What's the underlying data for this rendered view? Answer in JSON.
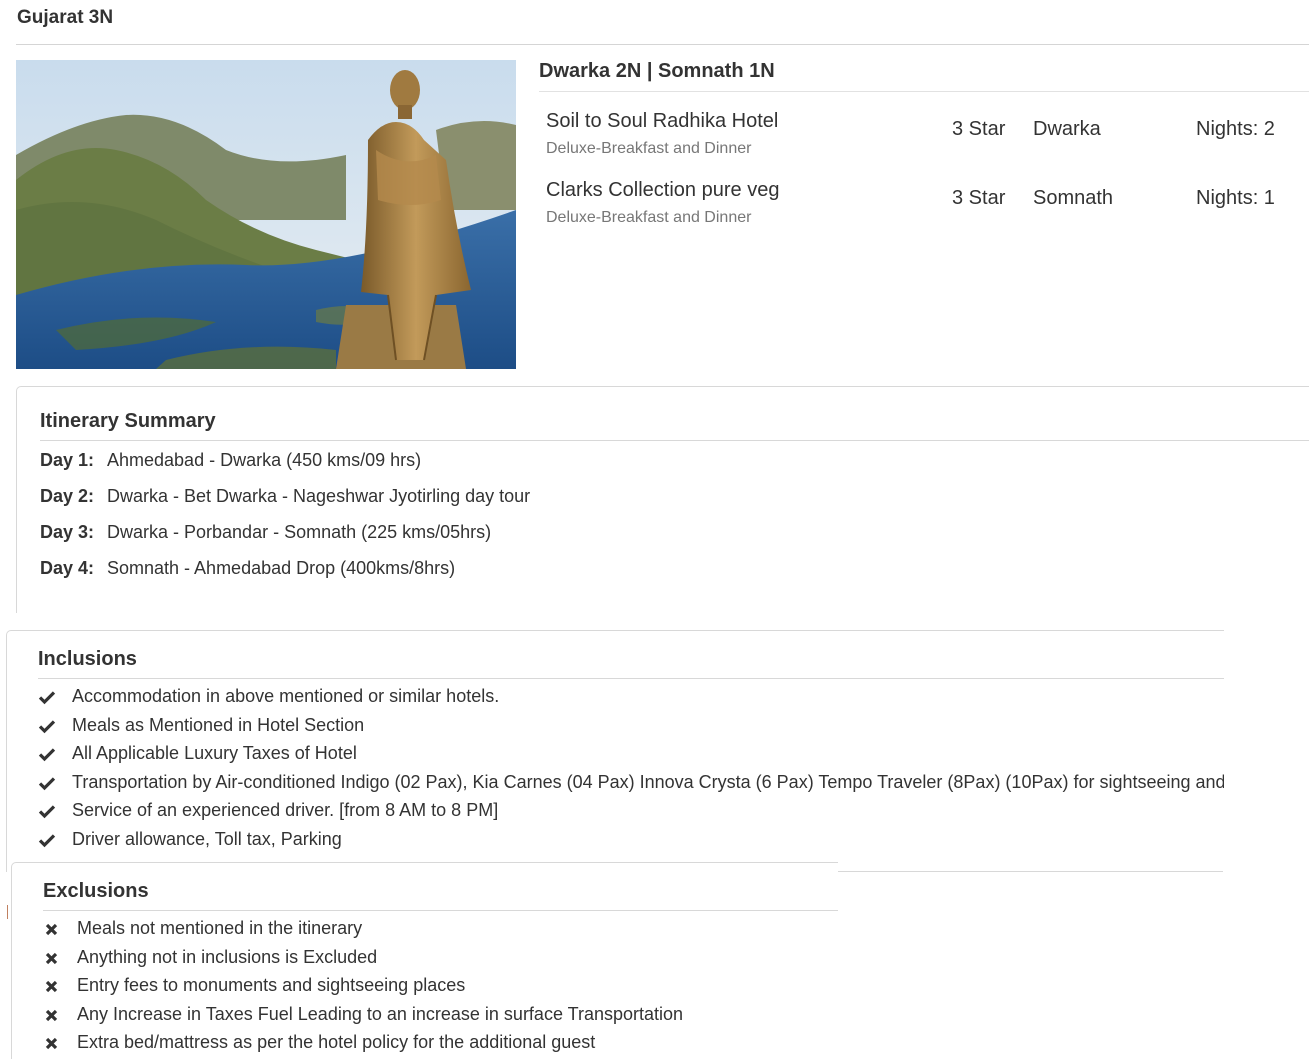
{
  "package": {
    "title": "Gujarat 3N"
  },
  "hero": {
    "alt_icon": "statue-of-unity-photo"
  },
  "hotels": {
    "route_title": "Dwarka 2N | Somnath 1N",
    "items": [
      {
        "name": "Soil to Soul Radhika Hotel",
        "meal_plan": "Deluxe-Breakfast and Dinner",
        "rating": "3 Star",
        "city": "Dwarka",
        "nights": "Nights: 2"
      },
      {
        "name": "Clarks Collection pure veg",
        "meal_plan": "Deluxe-Breakfast and Dinner",
        "rating": "3 Star",
        "city": "Somnath",
        "nights": "Nights: 1"
      }
    ]
  },
  "itinerary": {
    "title": "Itinerary Summary",
    "days": [
      {
        "label": "Day 1:",
        "text": "Ahmedabad - Dwarka (450 kms/09 hrs)"
      },
      {
        "label": "Day 2:",
        "text": "Dwarka - Bet Dwarka - Nageshwar Jyotirling day tour"
      },
      {
        "label": "Day 3:",
        "text": "Dwarka - Porbandar - Somnath (225 kms/05hrs)"
      },
      {
        "label": "Day 4:",
        "text": "Somnath - Ahmedabad Drop (400kms/8hrs)"
      }
    ]
  },
  "inclusions": {
    "title": "Inclusions",
    "icon": "check-icon",
    "items": [
      "Accommodation in above mentioned or similar hotels.",
      "Meals as Mentioned in Hotel Section",
      "All Applicable Luxury Taxes of Hotel",
      "Transportation by Air-conditioned Indigo (02 Pax), Kia Carnes (04 Pax) Innova Crysta (6 Pax) Tempo Traveler (8Pax) (10Pax) for sightseeing and",
      "Service of an experienced driver. [from 8 AM to 8 PM]",
      "Driver allowance, Toll tax, Parking"
    ]
  },
  "exclusions": {
    "title": "Exclusions",
    "icon": "cross-icon",
    "items": [
      "Meals not mentioned in the itinerary",
      "Anything not in inclusions is Excluded",
      "Entry fees to monuments and sightseeing places",
      "Any Increase in Taxes Fuel Leading to an increase in surface Transportation",
      "Extra bed/mattress as per the hotel policy for the additional guest"
    ]
  },
  "colors": {
    "text": "#333333",
    "muted": "#777777",
    "rule": "#d8d8d8"
  }
}
